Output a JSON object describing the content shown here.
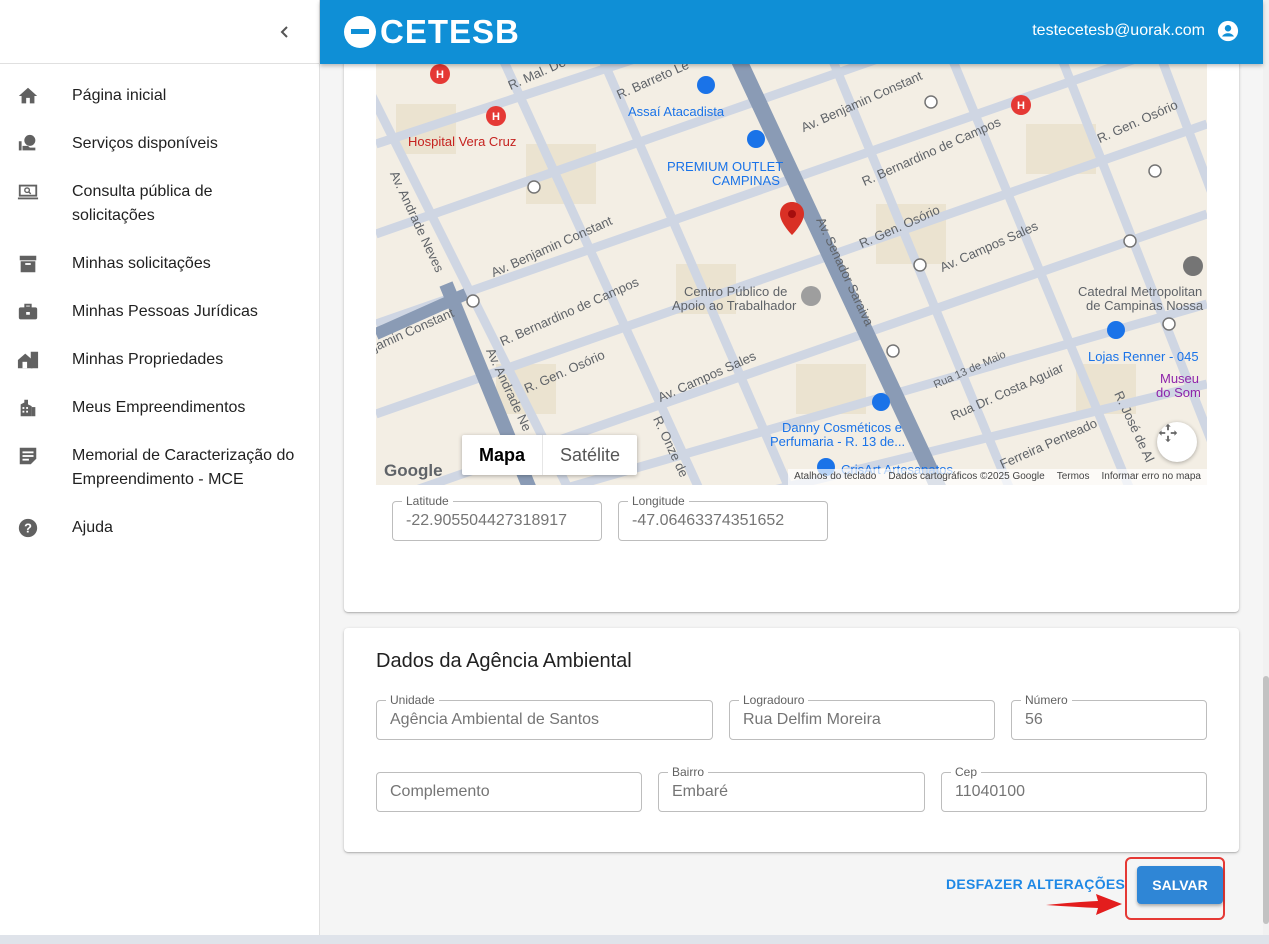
{
  "sidebar": {
    "collapse_icon": "chevron-left-icon",
    "items": [
      {
        "label": "Página inicial",
        "icon": "home-icon"
      },
      {
        "label": "Serviços disponíveis",
        "icon": "services-icon"
      },
      {
        "label": "Consulta pública de solicitações",
        "icon": "laptop-search-icon"
      },
      {
        "label": "Minhas solicitações",
        "icon": "archive-icon"
      },
      {
        "label": "Minhas Pessoas Jurídicas",
        "icon": "briefcase-icon"
      },
      {
        "label": "Minhas Propriedades",
        "icon": "property-icon"
      },
      {
        "label": "Meus Empreendimentos",
        "icon": "building-icon"
      },
      {
        "label": "Memorial de Caracterização do Empreendimento - MCE",
        "icon": "document-icon"
      },
      {
        "label": "Ajuda",
        "icon": "help-icon"
      }
    ]
  },
  "header": {
    "logo_text": "CETESB",
    "user_email": "testecetesb@uorak.com",
    "brand_color": "#0f8fd6"
  },
  "map": {
    "type_buttons": [
      "Mapa",
      "Satélite"
    ],
    "selected_type": "Mapa",
    "google": "Google",
    "attribution": [
      "Atalhos do teclado",
      "Dados cartográficos ©2025 Google",
      "Termos",
      "Informar erro no mapa"
    ],
    "labels": {
      "hospital": "Hospital Vera Cruz",
      "assai": "Assaí Atacadista",
      "outlet1": "PREMIUM OUTLET",
      "outlet2": "CAMPINAS",
      "centro1": "Centro Público de",
      "centro2": "Apoio ao Trabalhador",
      "catedral1": "Catedral Metropolitan",
      "catedral2": "de Campinas Nossa",
      "renner": "Lojas Renner - 045",
      "museu1": "Museu",
      "museu2": "do Som",
      "danny1": "Danny Cosméticos e",
      "danny2": "Perfumaria - R. 13 de...",
      "crisart": "CrisArt Artesanatos",
      "benjamin": "Av. Benjamin Constant",
      "benjamin2": "Av. Benjamin Constant",
      "benjamin3": "jamin Constant",
      "bernardino": "R. Bernardino de Campos",
      "bernardino2": "R. Bernardino de Campos",
      "osorio": "R. Gen. Osório",
      "osorio2": "R. Gen. Osório",
      "osorio3": "R. Gen. Osório",
      "campos": "Av. Campos Sales",
      "campos2": "Av. Campos Sales",
      "saraiva": "Av. Senador Saraiva",
      "andrade": "Av. Andrade Neves",
      "andrade2": "Av. Andrade Ne",
      "costa": "Rua Dr. Costa Aguiar",
      "treze": "Rua 13 de Maio",
      "ferreira": "Ferreira Penteado",
      "barreto": "R. Barreto Le",
      "mal": "R. Mal. De",
      "onze": "R. Onze de",
      "jose": "R. José de Al"
    }
  },
  "coords": {
    "latitude_label": "Latitude",
    "latitude": "-22.905504427318917",
    "longitude_label": "Longitude",
    "longitude": "-47.06463374351652"
  },
  "agency": {
    "title": "Dados da Agência Ambiental",
    "unidade_label": "Unidade",
    "unidade": "Agência Ambiental de Santos",
    "logradouro_label": "Logradouro",
    "logradouro": "Rua Delfim Moreira",
    "numero_label": "Número",
    "numero": "56",
    "complemento_placeholder": "Complemento",
    "bairro_label": "Bairro",
    "bairro": "Embaré",
    "cep_label": "Cep",
    "cep": "11040100"
  },
  "actions": {
    "undo_label": "DESFAZER ALTERAÇÕES",
    "save_label": "SALVAR",
    "accent": "#2f86d6",
    "highlight": "#e53935"
  }
}
